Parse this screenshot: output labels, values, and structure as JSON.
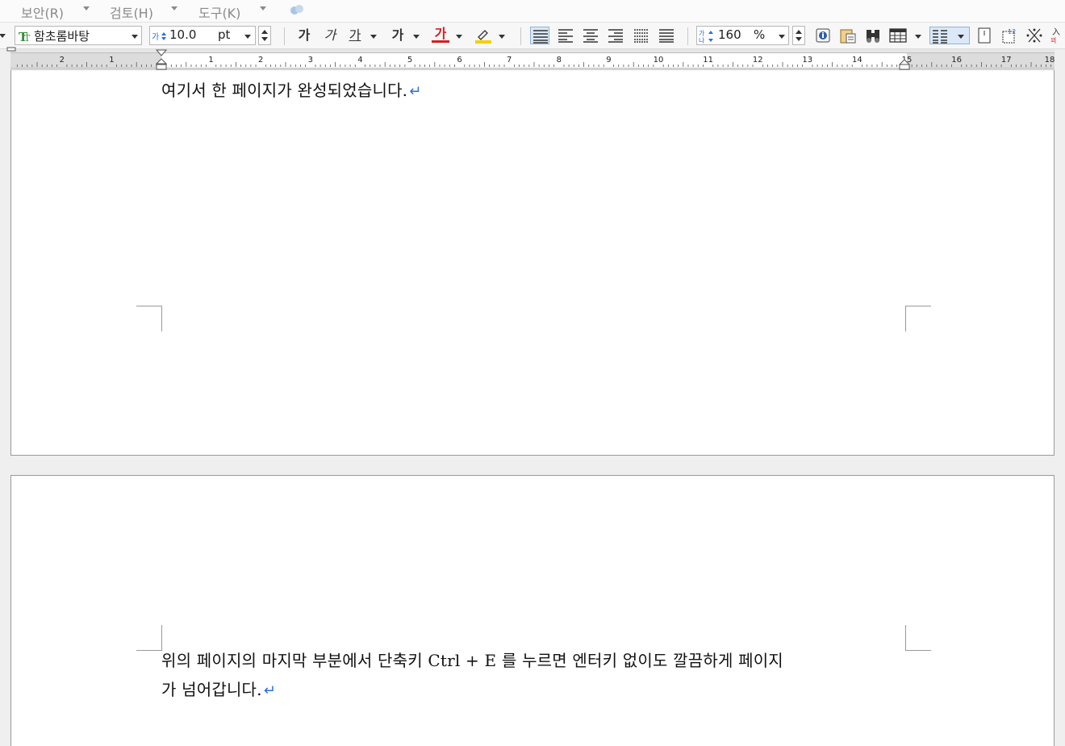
{
  "menubar": {
    "items": [
      {
        "label": "보안(R)"
      },
      {
        "label": "검토(H)"
      },
      {
        "label": "도구(K)"
      }
    ]
  },
  "toolbar": {
    "font_name": "함초롬바탕",
    "font_size": "10.0",
    "font_unit": "pt",
    "bold_label": "가",
    "italic_label": "가",
    "underline_label": "가",
    "strike_label": "가",
    "color_label": "가",
    "line_spacing_value": "160",
    "line_spacing_unit": "%",
    "colors": {
      "font_color": "#d42020",
      "highlight": "#f5d000",
      "font_icon": "#3a8f3a"
    }
  },
  "ruler": {
    "labels": [
      "2",
      "1",
      "1",
      "2",
      "3",
      "4",
      "5",
      "6",
      "7",
      "8",
      "9",
      "10",
      "11",
      "12",
      "13",
      "14",
      "15",
      "16",
      "17",
      "18"
    ]
  },
  "document": {
    "page1_line": "여기서 한 페이지가 완성되었습니다.",
    "page2_line1": "위의 페이지의 마지막 부분에서 단축키 Ctrl + E 를 누르면 엔터키 없이도 깔끔하게 페이지",
    "page2_line2": "가 넘어갑니다.",
    "para_mark": "↵"
  }
}
